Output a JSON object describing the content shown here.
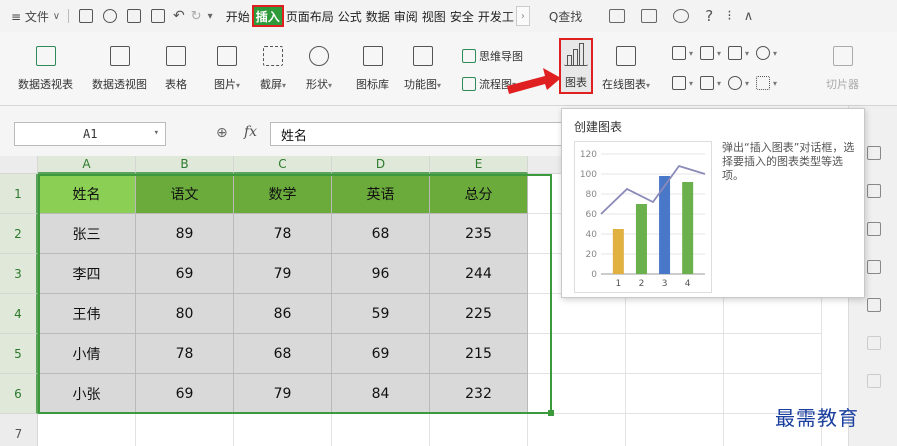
{
  "menubar": {
    "menu_label": "≡ 文件",
    "menu_arrow": "∨",
    "redo_arrow": "↻",
    "more_arrow": "▾",
    "tabs": [
      {
        "label": "开始",
        "active": false
      },
      {
        "label": "插入",
        "active": true
      },
      {
        "label": "页面布局",
        "active": false
      },
      {
        "label": "公式",
        "active": false
      },
      {
        "label": "数据",
        "active": false
      },
      {
        "label": "审阅",
        "active": false
      },
      {
        "label": "视图",
        "active": false
      },
      {
        "label": "安全",
        "active": false
      },
      {
        "label": "开发工",
        "active": false
      }
    ],
    "overflow": "›",
    "search_label": "Q查找",
    "help": "?",
    "kebab": "⁝",
    "collapse": "∧"
  },
  "ribbon": {
    "pivot_table": "数据透视表",
    "pivot_chart": "数据透视图",
    "table": "表格",
    "picture": "图片",
    "screenshot": "截屏",
    "shape": "形状",
    "icon_library": "图标库",
    "function_chart": "功能图",
    "mind_map": "思维导图",
    "flowchart": "流程图",
    "chart": "图表",
    "online_chart": "在线图表",
    "slicer": "切片器",
    "dropdown": "▾"
  },
  "formula_bar": {
    "cell_ref": "A1",
    "zoom_icon": "⊕",
    "fx_label": "fx",
    "content": "姓名"
  },
  "sheet": {
    "columns": [
      "A",
      "B",
      "C",
      "D",
      "E"
    ],
    "rows": [
      "1",
      "2",
      "3",
      "4",
      "5",
      "6",
      "7"
    ],
    "header": [
      "姓名",
      "语文",
      "数学",
      "英语",
      "总分"
    ],
    "data": [
      [
        "张三",
        "89",
        "78",
        "68",
        "235"
      ],
      [
        "李四",
        "69",
        "79",
        "96",
        "244"
      ],
      [
        "王伟",
        "80",
        "86",
        "59",
        "225"
      ],
      [
        "小倩",
        "78",
        "68",
        "69",
        "215"
      ],
      [
        "小张",
        "69",
        "79",
        "84",
        "232"
      ]
    ]
  },
  "tooltip": {
    "title": "创建图表",
    "description": "弹出“插入图表”对话框，选择要插入的图表类型等选项。",
    "chart_data": {
      "type": "bar",
      "categories": [
        "1",
        "2",
        "3",
        "4"
      ],
      "values": [
        45,
        70,
        98,
        92
      ],
      "line_values": [
        60,
        85,
        72,
        108,
        100
      ],
      "bar_colors": [
        "#e0b040",
        "#6ab04c",
        "#4a78c8",
        "#6ab04c"
      ],
      "line_color": "#8a8ab8",
      "yticks": [
        "0",
        "20",
        "40",
        "60",
        "80",
        "100",
        "120"
      ],
      "ylim": [
        0,
        120
      ]
    }
  },
  "watermark": "最需教育",
  "colors": {
    "accent_red": "#e02020",
    "header_green": "#6aab3c",
    "selection_green": "#3c9a3c"
  }
}
